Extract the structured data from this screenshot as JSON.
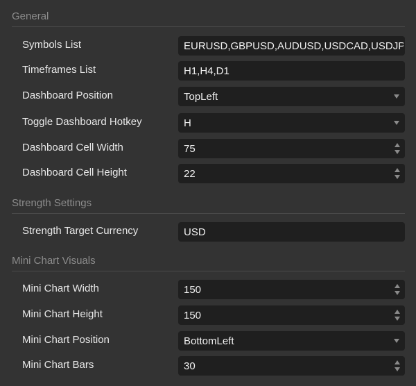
{
  "sections": [
    {
      "title": "General",
      "rows": [
        {
          "label": "Symbols List",
          "value": "EURUSD,GBPUSD,AUDUSD,USDCAD,USDJPY",
          "control": "text"
        },
        {
          "label": "Timeframes List",
          "value": "H1,H4,D1",
          "control": "text"
        },
        {
          "label": "Dashboard Position",
          "value": "TopLeft",
          "control": "select"
        },
        {
          "label": "Toggle Dashboard Hotkey",
          "value": "H",
          "control": "select"
        },
        {
          "label": "Dashboard Cell Width",
          "value": "75",
          "control": "spinner"
        },
        {
          "label": "Dashboard Cell Height",
          "value": "22",
          "control": "spinner"
        }
      ]
    },
    {
      "title": "Strength Settings",
      "rows": [
        {
          "label": "Strength Target Currency",
          "value": "USD",
          "control": "text"
        }
      ]
    },
    {
      "title": "Mini Chart Visuals",
      "rows": [
        {
          "label": "Mini Chart Width",
          "value": "150",
          "control": "spinner"
        },
        {
          "label": "Mini Chart Height",
          "value": "150",
          "control": "spinner"
        },
        {
          "label": "Mini Chart Position",
          "value": "BottomLeft",
          "control": "select"
        },
        {
          "label": "Mini Chart Bars",
          "value": "30",
          "control": "spinner"
        }
      ]
    }
  ],
  "icons": {
    "select": "chevron-down-icon",
    "spinner": "spin-up-down-icon"
  },
  "colors": {
    "panel_background": "#333333",
    "field_background": "#1f1f1f",
    "section_title": "#8c8c8c",
    "label_text": "#e8e8e8",
    "value_text": "#f0f0f0"
  }
}
